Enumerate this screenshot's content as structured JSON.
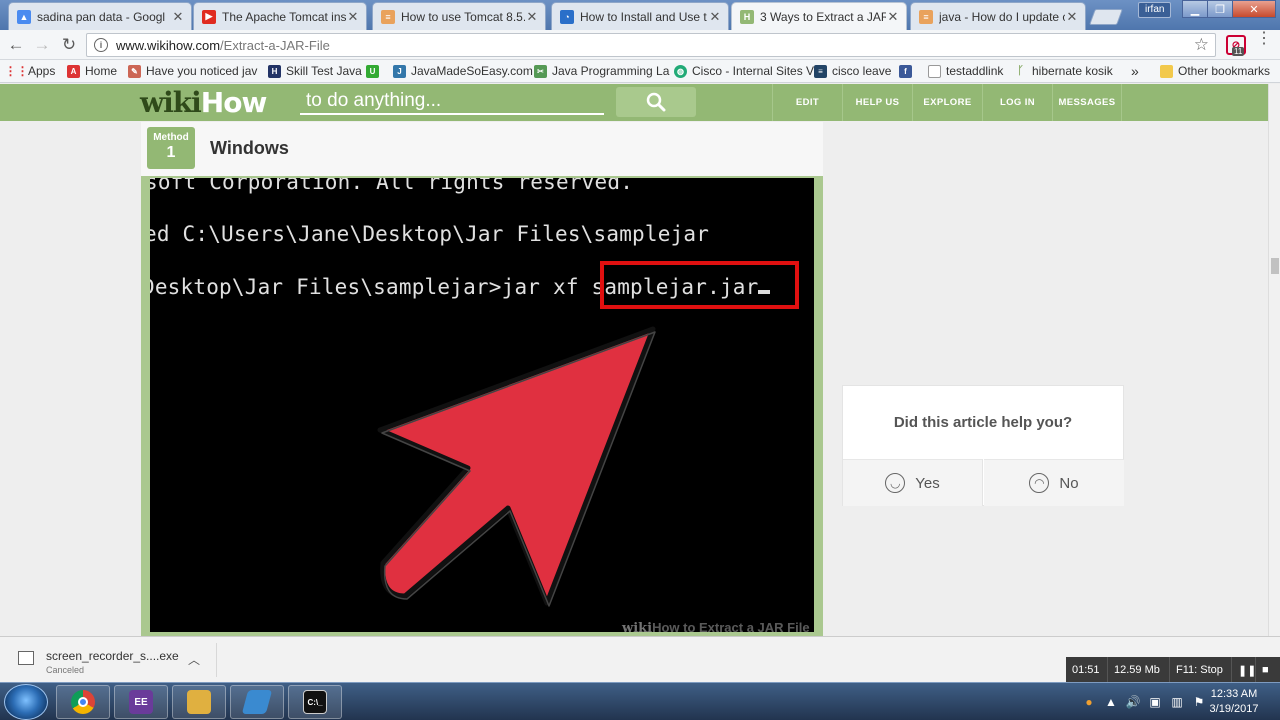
{
  "browser": {
    "tabs": [
      {
        "title": "sadina pan data - Googl",
        "favicon_color": "#4a8bf0",
        "active": false
      },
      {
        "title": "The Apache Tomcat inst",
        "favicon_color": "#e02b20",
        "active": false
      },
      {
        "title": "How to use Tomcat 8.5.",
        "favicon_color": "#e9a25c",
        "active": false
      },
      {
        "title": "How to Install and Use t",
        "favicon_color": "#2a6fc9",
        "active": false
      },
      {
        "title": "3 Ways to Extract a JAR",
        "favicon_color": "#93b874",
        "active": true
      },
      {
        "title": "java - How do I update c",
        "favicon_color": "#e9a25c",
        "active": false
      }
    ],
    "user_badge": "irfan",
    "url_host": "www.wikihow.com",
    "url_path": "/Extract-a-JAR-File",
    "extension_badge": "11",
    "bookmarks": [
      {
        "label": "Apps",
        "icon_color": "#d33"
      },
      {
        "label": "Home",
        "icon_color": "#d33"
      },
      {
        "label": "Have you noticed jav",
        "icon_color": "#c65"
      },
      {
        "label": "Skill Test Java",
        "icon_color": "#236"
      },
      {
        "label": "",
        "icon_color": "#3a3"
      },
      {
        "label": "JavaMadeSoEasy.com",
        "icon_color": "#37a"
      },
      {
        "label": "Java Programming La",
        "icon_color": "#595"
      },
      {
        "label": "Cisco - Internal Sites V",
        "icon_color": "#2a7"
      },
      {
        "label": "cisco leave",
        "icon_color": "#246"
      },
      {
        "label": "",
        "icon_color": "#3b5998"
      },
      {
        "label": "testaddlink",
        "icon_color": "#999"
      },
      {
        "label": "hibernate kosik",
        "icon_color": "#8a6"
      }
    ],
    "bookmarks_overflow": "»",
    "other_bookmarks": "Other bookmarks"
  },
  "wikihow": {
    "logo_wiki": "wiki",
    "logo_how": "How",
    "search_placeholder": "to do anything...",
    "nav": [
      "EDIT",
      "HELP US",
      "EXPLORE",
      "LOG IN",
      "MESSAGES"
    ],
    "method_label": "Method",
    "method_number": "1",
    "method_title": "Windows",
    "terminal_lines": [
      "soft Corporation. All rights reserved.",
      "ed C:\\Users\\Jane\\Desktop\\Jar Files\\samplejar",
      "Desktop\\Jar Files\\samplejar>jar xf samplejar.jar"
    ],
    "watermark_wiki": "wiki",
    "watermark_text": "How to Extract a JAR File",
    "feedback_question": "Did this article help you?",
    "feedback_yes": "Yes",
    "feedback_no": "No",
    "brand_color": "#93b874",
    "highlight_color": "#e01010",
    "arrow_color": "#e03040"
  },
  "downloads": {
    "file_name": "screen_recorder_s....exe",
    "status": "Canceled"
  },
  "recorder": {
    "elapsed": "01:51",
    "size": "12.59 Mb",
    "stop_hint": "F11: Stop"
  },
  "taskbar": {
    "apps": [
      {
        "name": "chrome",
        "color": "#e8a020"
      },
      {
        "name": "java-ee-ide",
        "color": "#6a3b9a"
      },
      {
        "name": "file-explorer",
        "color": "#e0b040"
      },
      {
        "name": "app",
        "color": "#3a8ad0"
      },
      {
        "name": "cmd",
        "color": "#111111"
      }
    ],
    "time": "12:33 AM",
    "date": "3/19/2017"
  }
}
